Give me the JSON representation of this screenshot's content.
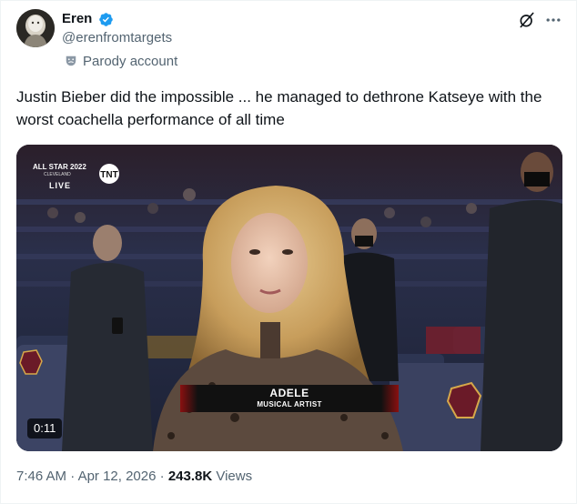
{
  "author": {
    "display_name": "Eren",
    "handle": "@erenfromtargets",
    "verified": true,
    "verified_color": "#1d9bf0",
    "label": "Parody account",
    "label_icon": "theater-masks-icon",
    "avatar_icon": "profile-avatar"
  },
  "header_actions": {
    "grok_icon": "grok-icon",
    "more_icon": "more-dots-icon"
  },
  "tweet": {
    "text": "Justin Bieber did the impossible ... he managed to dethrone Katseye with the worst coachella performance of all time"
  },
  "media": {
    "type": "video",
    "broadcast_badge": "ALL STAR 2022",
    "broadcast_badge_sub": "CLEVELAND",
    "network": "TNT",
    "live_label": "LIVE",
    "lower_third_name": "ADELE",
    "lower_third_title": "MUSICAL ARTIST",
    "seat_logo": "CAVALIERS",
    "seat_logo_top": "CLEVELAND",
    "duration": "0:11"
  },
  "footer": {
    "time": "7:46 AM",
    "separator": "·",
    "date": "Apr 12, 2026",
    "views_count": "243.8K",
    "views_label": "Views"
  },
  "colors": {
    "text_primary": "#0f1419",
    "text_secondary": "#536471",
    "accent": "#1d9bf0"
  }
}
